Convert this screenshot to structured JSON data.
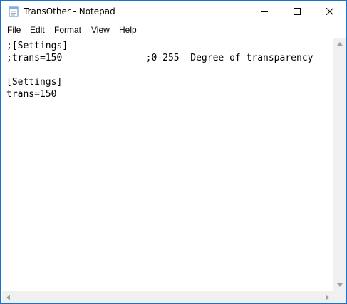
{
  "window": {
    "title": "TransOther - Notepad",
    "icon": "notepad-icon"
  },
  "title_buttons": {
    "minimize_icon": "minimize-icon",
    "maximize_icon": "maximize-icon",
    "close_icon": "close-icon"
  },
  "menubar": {
    "items": [
      "File",
      "Edit",
      "Format",
      "View",
      "Help"
    ]
  },
  "editor": {
    "lines": [
      ";[Settings]",
      ";trans=150               ;0-255  Degree of transparency",
      "",
      "[Settings]",
      "trans=150"
    ]
  },
  "colors": {
    "window_border": "#1a73c4",
    "scrollbar": "#f0f0f0"
  }
}
